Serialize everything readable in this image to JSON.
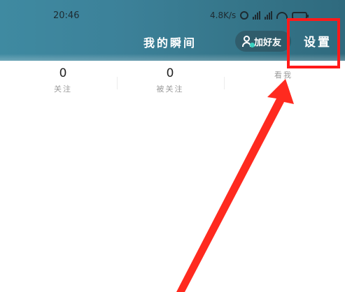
{
  "status_bar": {
    "time": "20:46",
    "net_speed": "4.8K/s"
  },
  "header": {
    "title": "我的瞬间",
    "add_friend_label": "加好友",
    "settings_label": "设置"
  },
  "stats": [
    {
      "value": "0",
      "label": "关注"
    },
    {
      "value": "0",
      "label": "被关注"
    },
    {
      "value": "",
      "label": "看我"
    }
  ],
  "colors": {
    "header_bg": "#3c8199",
    "highlight": "#ff1a1a",
    "arrow": "#ff2a1f"
  }
}
